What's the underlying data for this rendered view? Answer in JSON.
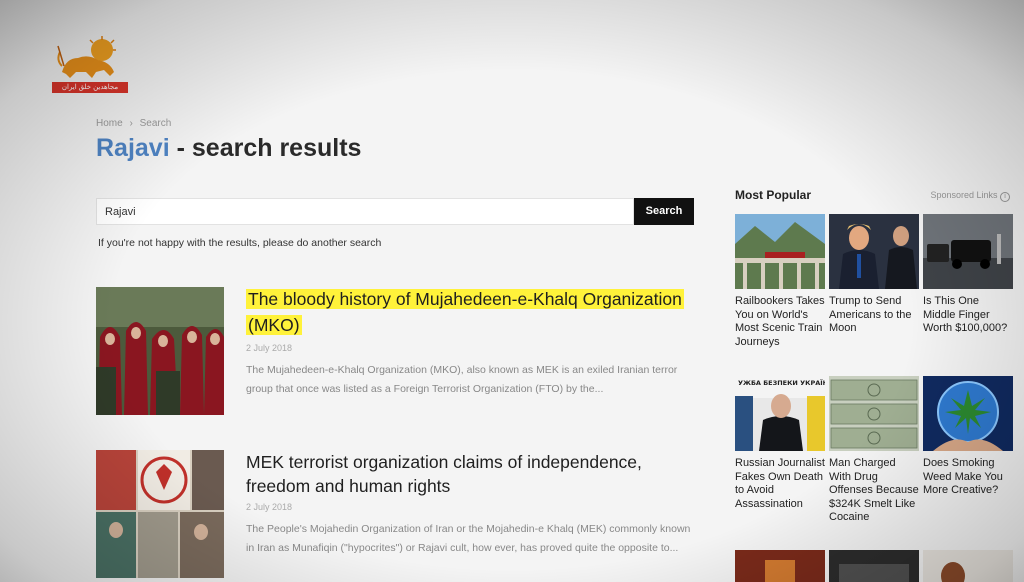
{
  "logo": {
    "text": "مجاهدین خلق ایران"
  },
  "breadcrumb": {
    "home": "Home",
    "sep": "›",
    "current": "Search"
  },
  "title": {
    "query": "Rajavi",
    "suffix": " - search results"
  },
  "search": {
    "value": "Rajavi",
    "button_label": "Search"
  },
  "hint": "If you're not happy with the results, please do another search",
  "results": [
    {
      "title": "The bloody history of Mujahedeen-e-Khalq Organization (MKO)",
      "date": "2 July 2018",
      "excerpt": "The Mujahedeen-e-Khalq Organization (MKO), also known as MEK is an exiled Iranian terror group that once was listed as a Foreign Terrorist Organization (FTO) by the..."
    },
    {
      "title": "MEK terrorist organization claims of independence, freedom and human rights",
      "date": "2 July 2018",
      "excerpt": "The People's Mojahedin Organization of Iran or the Mojahedin-e Khalq (MEK) commonly known in Iran as Munafiqin (\"hypocrites\") or Rajavi cult, how ever, has proved quite the opposite to..."
    }
  ],
  "sidebar": {
    "title": "Most Popular",
    "sponsored": "Sponsored Links",
    "cards": [
      {
        "caption": "Railbookers Takes You on World's Most Scenic Train Journeys"
      },
      {
        "caption": "Trump to Send Americans to the Moon"
      },
      {
        "caption": "Is This One Middle Finger Worth $100,000?"
      },
      {
        "caption": "Russian Journalist Fakes Own Death to Avoid Assassination",
        "image_text": "УЖБА БЕЗПЕКИ УКРАЇН"
      },
      {
        "caption": "Man Charged With Drug Offenses Because $324K Smelt Like Cocaine"
      },
      {
        "caption": "Does Smoking Weed Make You More Creative?"
      }
    ]
  },
  "colors": {
    "accent": "#4f84c4",
    "highlight": "#fff23a",
    "button": "#111111",
    "logo_red": "#d8342a"
  }
}
